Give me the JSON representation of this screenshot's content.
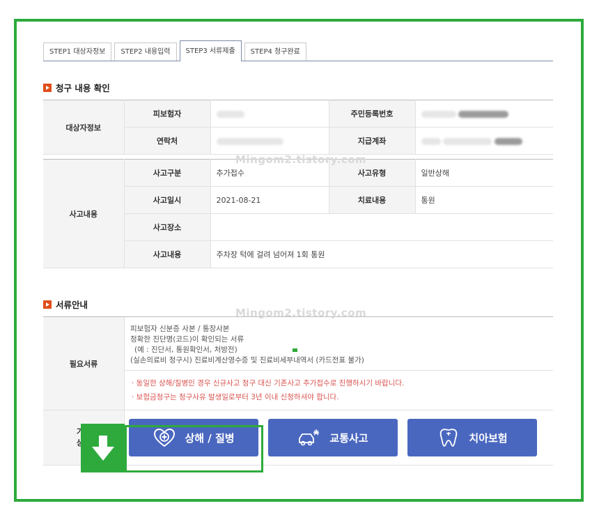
{
  "tabs": [
    {
      "label": "STEP1 대상자정보",
      "active": false
    },
    {
      "label": "STEP2 내용입력",
      "active": false
    },
    {
      "label": "STEP3 서류제출",
      "active": true
    },
    {
      "label": "STEP4 청구완료",
      "active": false
    }
  ],
  "claim_section": {
    "title": "청구 내용 확인",
    "subject_group": "대상자정보",
    "insured_label": "피보험자",
    "resident_no_label": "주민등록번호",
    "contact_label": "연락처",
    "payment_account_label": "지급계좌"
  },
  "accident_section": {
    "group": "사고내용",
    "type_label": "사고구분",
    "type_value": "추가접수",
    "kind_label": "사고유형",
    "kind_value": "일반상해",
    "date_label": "사고일시",
    "date_value": "2021-08-21",
    "treatment_label": "치료내용",
    "treatment_value": "통원",
    "place_label": "사고장소",
    "place_value": "",
    "content_label": "사고내용",
    "content_value": "주차장 턱에 걸려 넘어져 1회 통원"
  },
  "docs_section": {
    "title": "서류안내",
    "required_label": "필요서류",
    "lines": [
      "피보험자 신분증 사본 / 통장사본",
      "정확한 진단명(코드)이 확인되는 서류",
      "(예 : 진단서, 통원확인서, 처방전)",
      "(실손의료비 청구시) 진료비계산영수증 및 진료비세부내역서 (카드전표 불가)"
    ],
    "notes": [
      "· 동일한 상해/질병인 경우 신규사고 청구 대신 기존사고 추가접수로 진행하시기 바랍니다.",
      "· 보험금청구는 청구사유 발생일로부터 3년 이내 신청하셔야 합니다."
    ],
    "other_label_1": "기타",
    "other_label_2": "상세"
  },
  "buttons": {
    "injury_illness": "상해 / 질병",
    "traffic_accident": "교통사고",
    "dental_insurance": "치아보험"
  },
  "watermark": "Mingom2.tistory.com",
  "colors": {
    "frame_green": "#2eaa3c",
    "button_blue": "#4a67bf",
    "section_mark": "#e04e1a",
    "notice_red": "#d9534f"
  }
}
